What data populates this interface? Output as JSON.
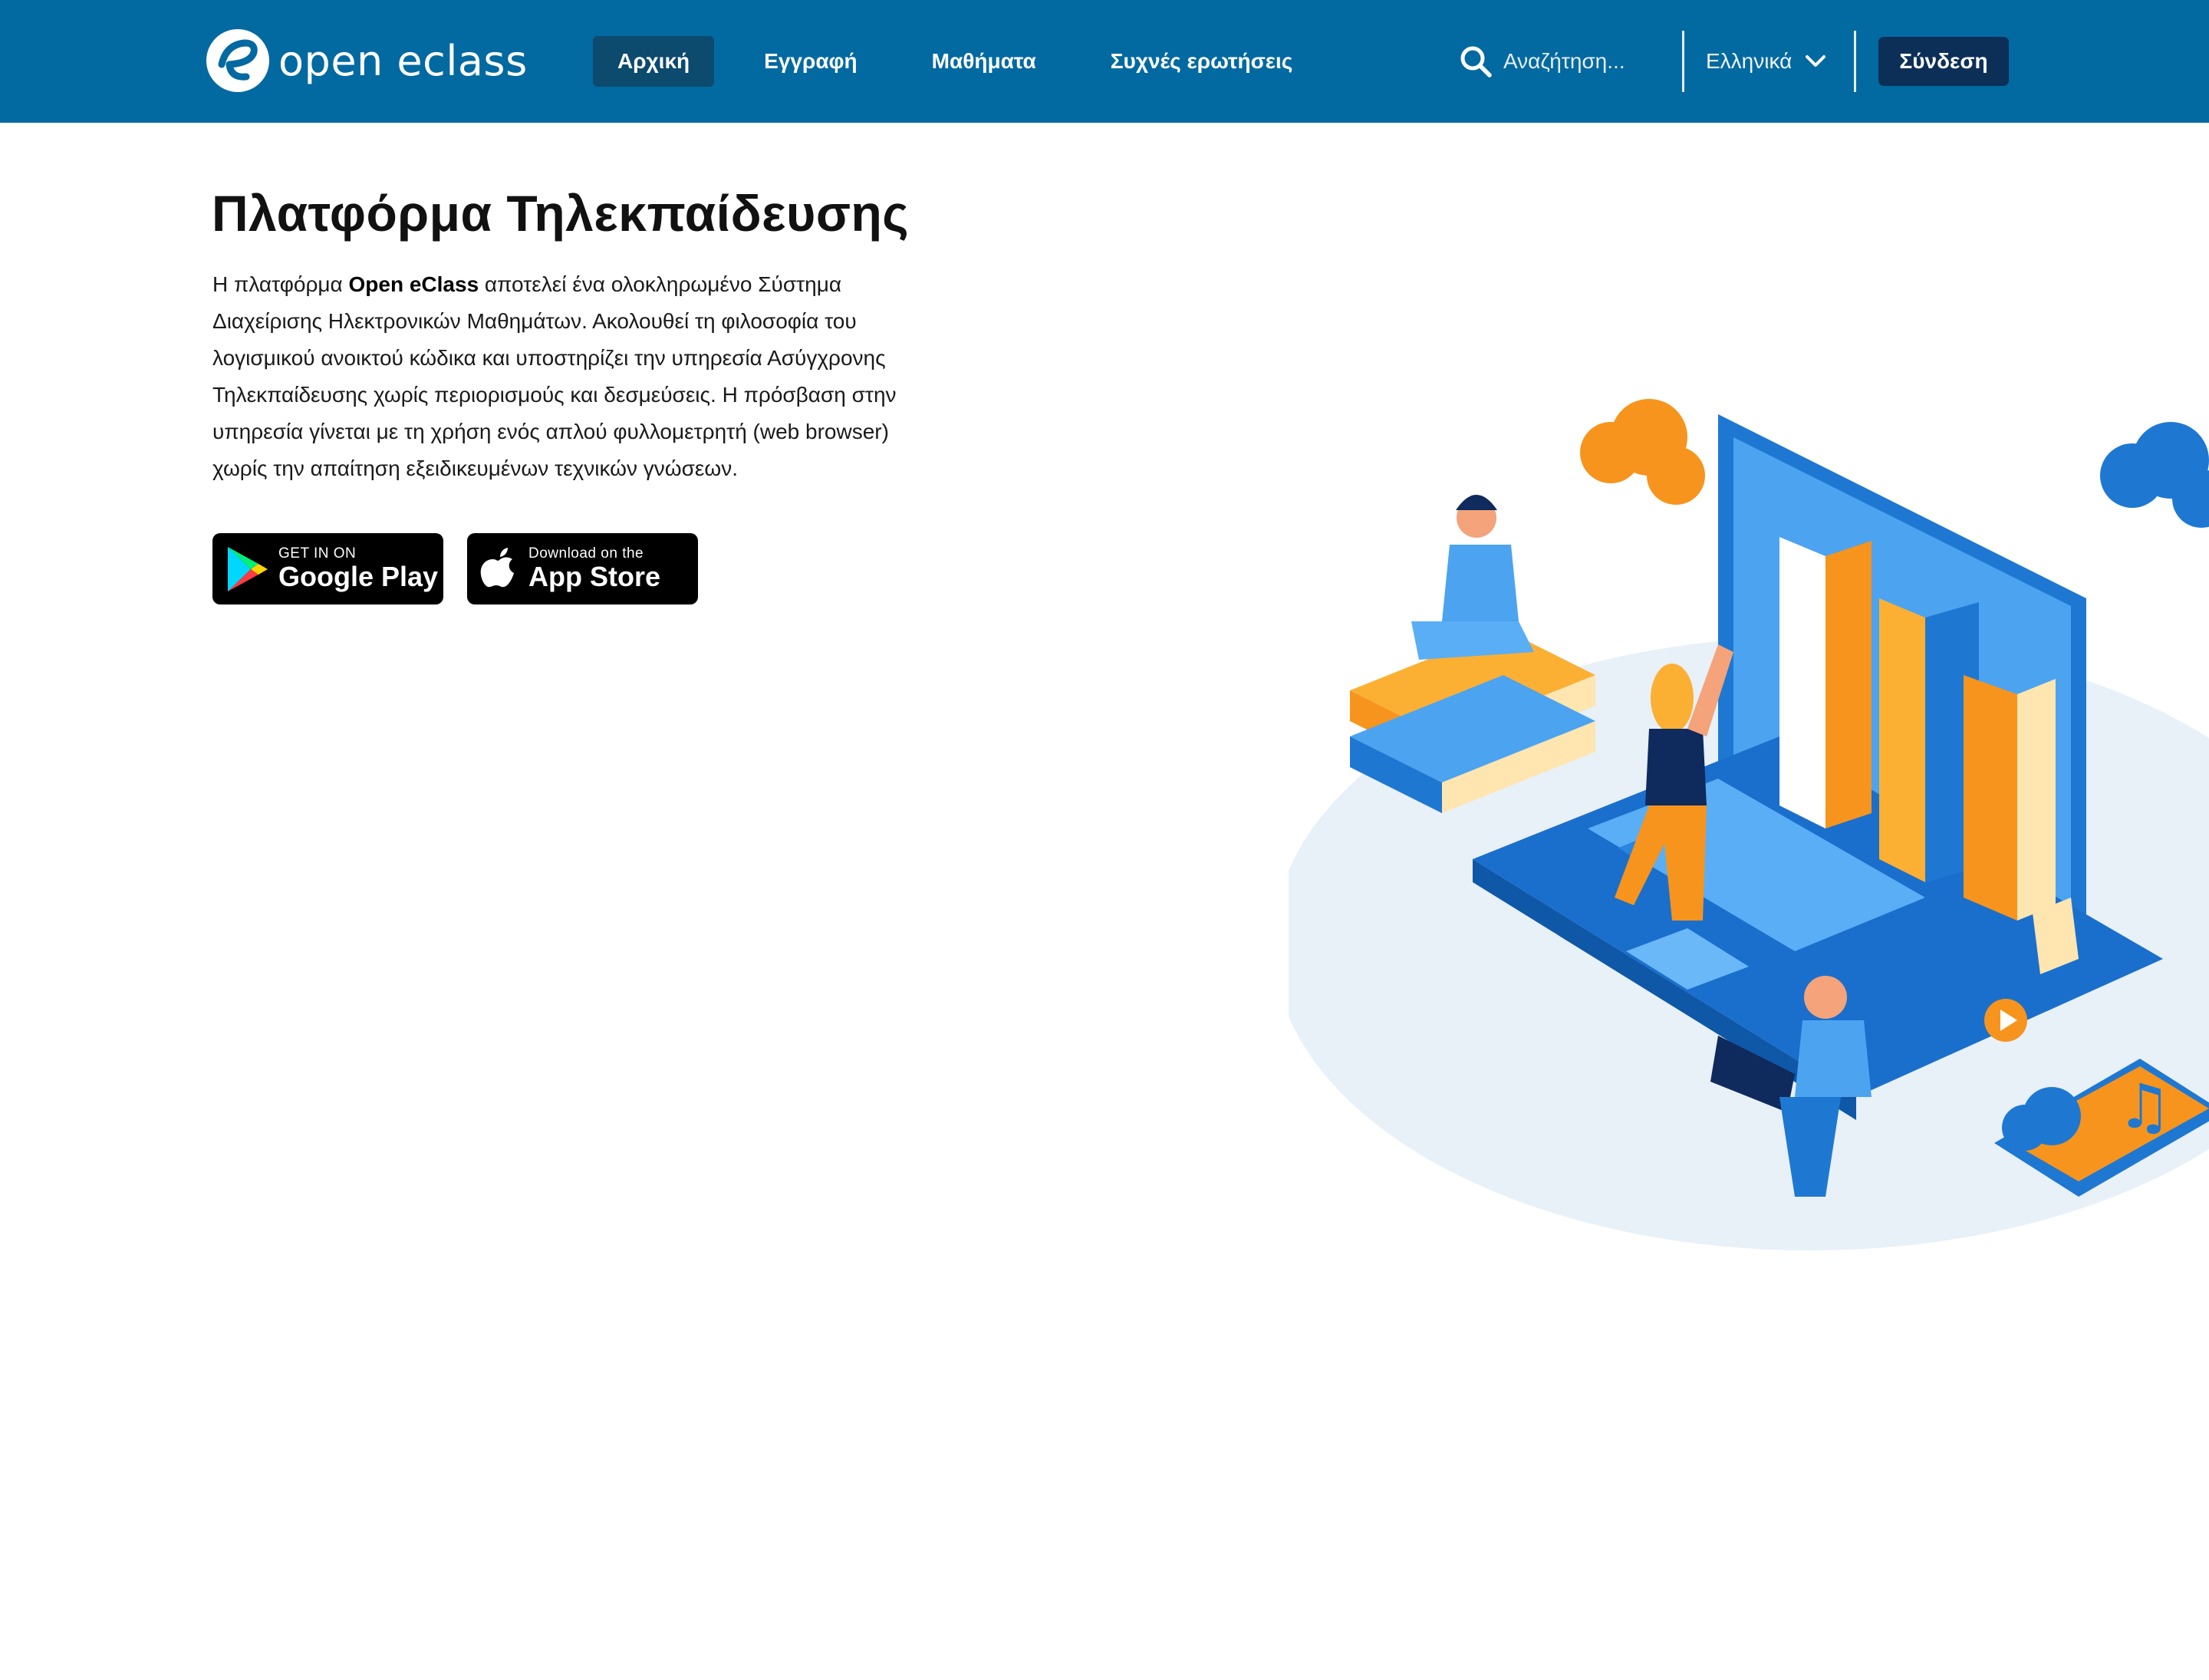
{
  "header": {
    "logo_text": "open eclass",
    "nav": [
      {
        "label": "Αρχική",
        "active": true
      },
      {
        "label": "Εγγραφή",
        "active": false
      },
      {
        "label": "Μαθήματα",
        "active": false
      },
      {
        "label": "Συχνές ερωτήσεις",
        "active": false
      }
    ],
    "search": {
      "placeholder": "Αναζήτηση...",
      "value": "",
      "icon": "search-icon"
    },
    "language": {
      "selected": "Ελληνικά",
      "icon": "chevron-down-icon"
    },
    "login_label": "Σύνδεση"
  },
  "main": {
    "title": "Πλατφόρμα Τηλεκπαίδευσης",
    "description": {
      "prefix": "Η πλατφόρμα ",
      "bold": "Open eClass",
      "suffix": " αποτελεί ένα ολοκληρωμένο Σύστημα Διαχείρισης Ηλεκτρονικών Μαθημάτων. Ακολουθεί τη φιλοσοφία του λογισμικού ανοικτού κώδικα και υποστηρίζει την υπηρεσία Ασύγχρονης Τηλεκπαίδευσης χωρίς περιορισμούς και δεσμεύσεις. Η πρόσβαση στην υπηρεσία γίνεται με τη χρήση ενός απλού φυλλομετρητή (web browser) χωρίς την απαίτηση εξειδικευμένων τεχνικών γνώσεων."
    },
    "stores": {
      "google": {
        "small": "GET IN ON",
        "big": "Google Play",
        "icon": "google-play-icon"
      },
      "apple": {
        "small": "Download on the",
        "big": "App Store",
        "icon": "apple-icon"
      }
    }
  },
  "colors": {
    "header_bg": "#0369a1",
    "nav_active_bg": "#0c4a6e",
    "login_bg": "#0c2f57",
    "illustration_orange": "#f7941d",
    "illustration_blue": "#1e78d2"
  }
}
